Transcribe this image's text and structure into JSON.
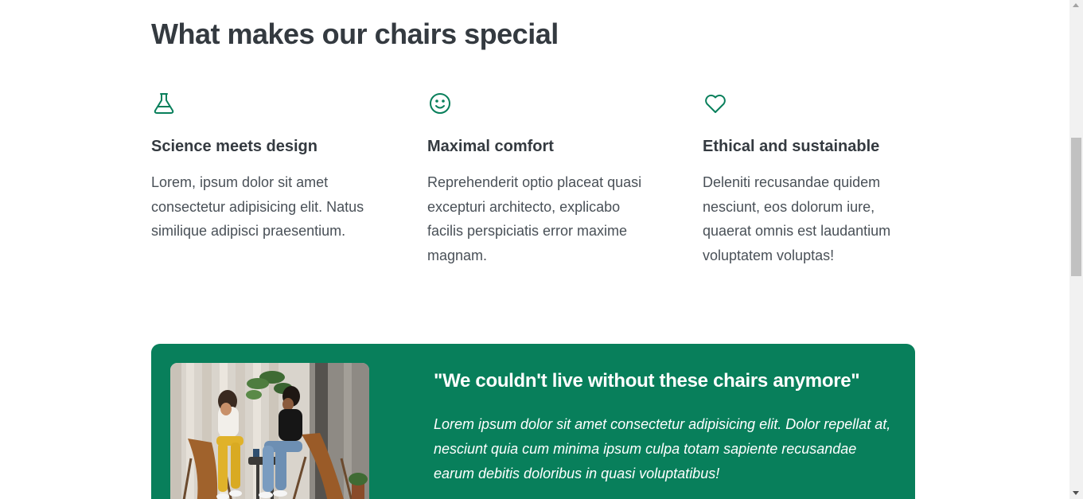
{
  "section": {
    "title": "What makes our chairs special"
  },
  "features": [
    {
      "icon": "flask-icon",
      "title": "Science meets design",
      "text": "Lorem, ipsum dolor sit amet consectetur adipisicing elit. Natus similique adipisci praesentium."
    },
    {
      "icon": "smile-icon",
      "title": "Maximal comfort",
      "text": "Reprehenderit optio placeat quasi excepturi architecto, explicabo facilis perspiciatis error maxime magnam."
    },
    {
      "icon": "heart-icon",
      "title": "Ethical and sustainable",
      "text": "Deleniti recusandae quidem nesciunt, eos dolorum iure, quaerat omnis est laudantium voluptatem voluptas!"
    }
  ],
  "testimonial": {
    "photo": "two-women-sitting-in-chairs-photo",
    "quote_title": "\"We couldn't live without these chairs anymore\"",
    "quote_text": "Lorem ipsum dolor sit amet consectetur adipisicing elit. Dolor repellat at, nesciunt quia cum minima ipsum culpa totam sapiente recusandae earum debitis doloribus in quasi voluptatibus!"
  },
  "colors": {
    "accent": "#087f5b",
    "heading": "#343a40",
    "body": "#495057"
  }
}
